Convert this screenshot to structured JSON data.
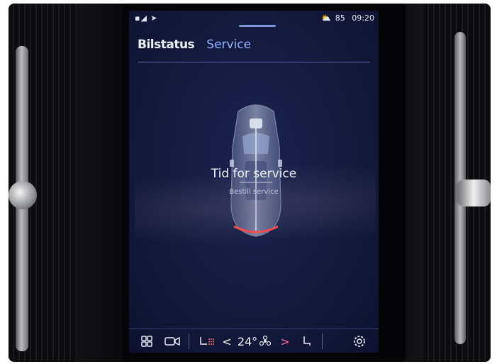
{
  "status_bar": {
    "left_icons": "signal-and-location",
    "right_temp": "85",
    "time": "09:20"
  },
  "tabs": [
    {
      "label": "Bilstatus",
      "active": true
    },
    {
      "label": "Service",
      "active": false
    }
  ],
  "service": {
    "title": "Tid for service",
    "subtitle": "Bestill service"
  },
  "bottom_bar": {
    "temperature": "24°",
    "fan_icon": "fan-icon",
    "prev_arrow": "<",
    "next_arrow": ">"
  },
  "colors": {
    "screen_bg": "#141a3d",
    "accent_blue": "#8fb3ff",
    "alert_red": "#ff4a4a"
  }
}
